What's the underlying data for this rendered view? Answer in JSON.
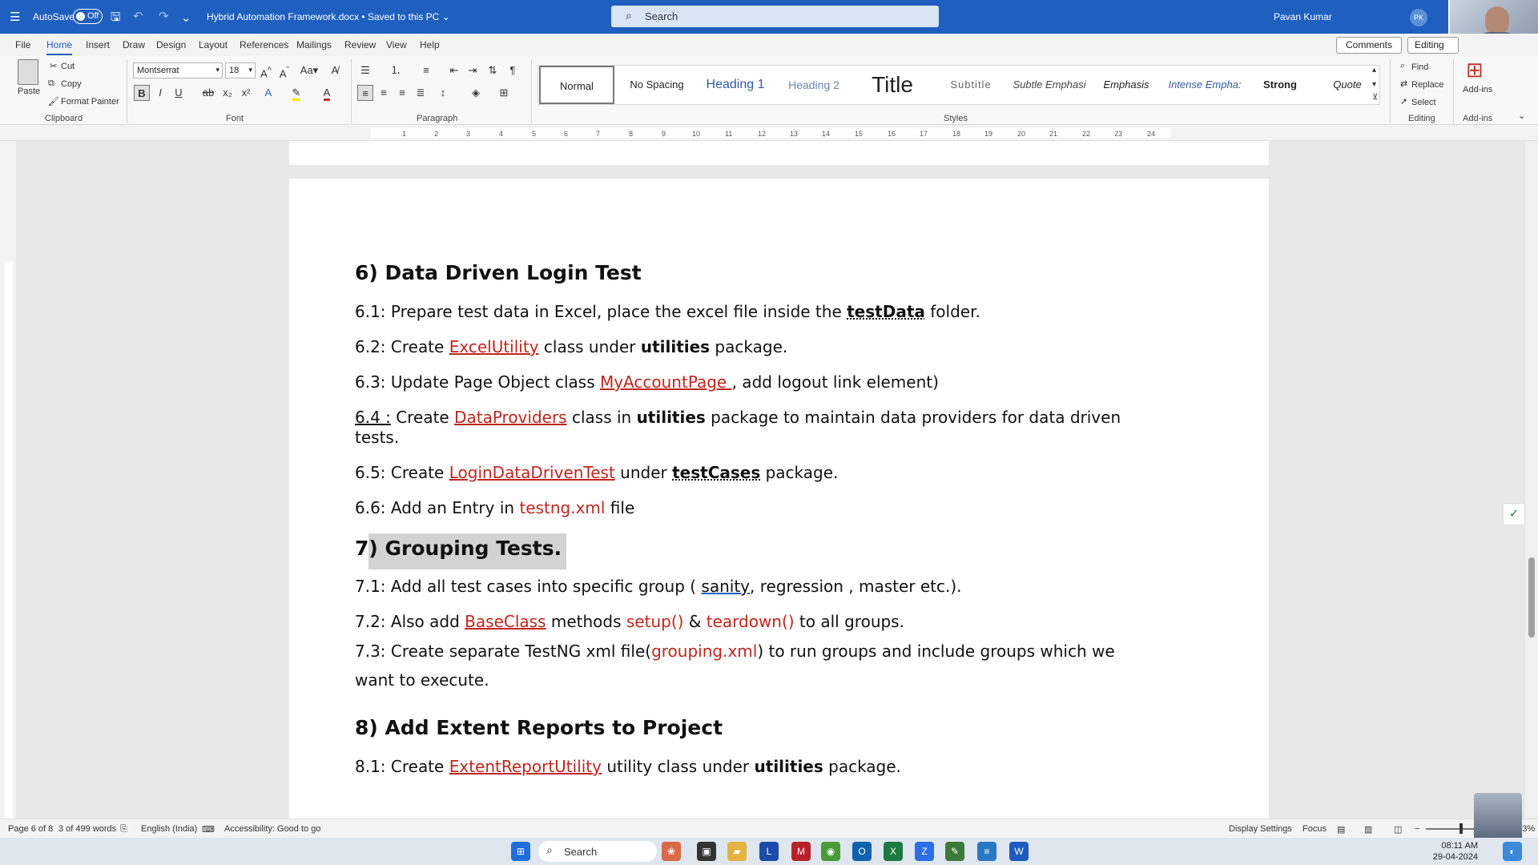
{
  "titlebar": {
    "autosave_label": "AutoSave",
    "autosave_state": "Off",
    "document_title": "Hybrid Automation Framework.docx • Saved to this PC ⌄",
    "search_placeholder": "Search",
    "user_name": "Pavan Kumar",
    "user_initials": "PK"
  },
  "menu": {
    "tabs": [
      "File",
      "Home",
      "Insert",
      "Draw",
      "Design",
      "Layout",
      "References",
      "Mailings",
      "Review",
      "View",
      "Help"
    ],
    "comments": "Comments",
    "editing": "Editing"
  },
  "ribbon": {
    "paste": "Paste",
    "cut": "Cut",
    "copy": "Copy",
    "format_painter": "Format Painter",
    "font_name": "Montserrat",
    "font_size": "18",
    "styles": [
      "Normal",
      "No Spacing",
      "Heading 1",
      "Heading 2",
      "Title",
      "Subtitle",
      "Subtle Emphasi",
      "Emphasis",
      "Intense Empha:",
      "Strong",
      "Quote"
    ],
    "find": "Find",
    "replace": "Replace",
    "select": "Select",
    "addins": "Add-ins",
    "groups": {
      "clipboard": "Clipboard",
      "font": "Font",
      "paragraph": "Paragraph",
      "styles": "Styles",
      "editing": "Editing",
      "addins": "Add-ins"
    }
  },
  "ruler_numbers": [
    "1",
    "2",
    "3",
    "4",
    "5",
    "6",
    "7",
    "8",
    "9",
    "10",
    "11",
    "12",
    "13",
    "14",
    "15",
    "16",
    "17",
    "18",
    "19",
    "20",
    "21",
    "22",
    "23",
    "24"
  ],
  "document": {
    "h6": "6) Data Driven Login Test",
    "l61a": "6.1: Prepare test data in Excel, place the excel file inside the ",
    "l61b": "testData",
    "l61c": " folder.",
    "l62a": "6.2: Create ",
    "l62b": "ExcelUtility",
    "l62c": " class under ",
    "l62d": "utilities",
    "l62e": " package.",
    "l63a": "6.3: Update Page Object class ",
    "l63b": "MyAccountPage ",
    "l63c": ", add logout link element)",
    "l64a": "6.4 :",
    "l64b": " Create ",
    "l64c": "DataProviders",
    "l64d": " class in ",
    "l64e": "utilities",
    "l64f": " package to maintain data providers for data driven",
    "l64g": "tests.",
    "l65a": "6.5: Create ",
    "l65b": "LoginDataDrivenTest",
    "l65c": " under ",
    "l65d": "testCases",
    "l65e": " package.",
    "l66a": "6.6: Add an Entry in ",
    "l66b": "testng.xml",
    "l66c": " file",
    "h7a": "7",
    "h7b": ") Grouping Tests.",
    "l71a": "7.1: Add all test cases into specific group ( ",
    "l71b": "sanity",
    "l71c": ", regression , master etc.).",
    "l72a": "7.2: Also add ",
    "l72b": "BaseClass",
    "l72c": " methods ",
    "l72d": "setup()",
    "l72e": " & ",
    "l72f": "teardown()",
    "l72g": " to all groups.",
    "l73a": "7.3: Create separate TestNG xml file(",
    "l73b": "grouping.xml",
    "l73c": ") to run groups and include groups which we",
    "l73d": "want to execute.",
    "h8": "8) Add Extent Reports to Project",
    "l81a": "8.1: Create ",
    "l81b": "ExtentReportUtility",
    "l81c": " utility class under ",
    "l81d": "utilities",
    "l81e": " package."
  },
  "status": {
    "page": "Page 6 of 8",
    "words": "3 of 499 words",
    "language": "English (India)",
    "accessibility": "Accessibility: Good to go",
    "display_settings": "Display Settings",
    "focus": "Focus",
    "zoom": "123%"
  },
  "taskbar": {
    "search": "Search",
    "time": "08:11 AM",
    "date": "29-04-2024"
  },
  "colors": {
    "titlebar": "#1f5fbf",
    "link_red": "#c0261d",
    "highlight": "#d3d3d3"
  }
}
